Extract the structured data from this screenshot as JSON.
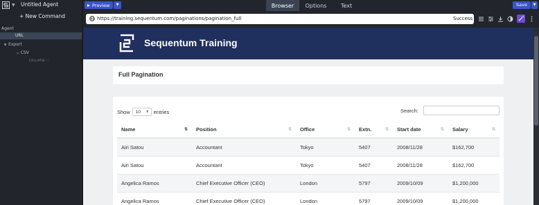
{
  "agent": {
    "title": "Untitled Agent",
    "new_command": "+ New Command"
  },
  "tree": {
    "agent": "Agent",
    "url": "URL",
    "export": "Export",
    "csv": "CSV",
    "collapse": "COLLAPSE"
  },
  "toolbar": {
    "preview": "Preview",
    "save": "Save",
    "tabs": [
      "Browser",
      "Options",
      "Text"
    ]
  },
  "address": {
    "url": "https://training.sequentum.com/paginations/pagination_full",
    "status": "Success"
  },
  "site": {
    "name": "Sequentum Training",
    "page_title": "Full Pagination"
  },
  "table": {
    "show_label": "Show",
    "entries_value": "10",
    "entries_label": "entries",
    "search_label": "Search:",
    "columns": [
      "Name",
      "Position",
      "Office",
      "Extn.",
      "Start date",
      "Salary"
    ],
    "rows": [
      [
        "Airi Satou",
        "Accountant",
        "Tokyo",
        "5407",
        "2008/11/28",
        "$162,700"
      ],
      [
        "Airi Satou",
        "Accountant",
        "Tokyo",
        "5407",
        "2008/11/28",
        "$162,700"
      ],
      [
        "Angelica Ramos",
        "Chief Executive Officer (CEO)",
        "London",
        "5797",
        "2009/10/09",
        "$1,200,000"
      ],
      [
        "Angelica Ramos",
        "Chief Executive Officer (CEO)",
        "London",
        "5797",
        "2009/10/09",
        "$1,200,000"
      ]
    ]
  },
  "colors": {
    "accent": "#3a55c9",
    "site_header": "#1f2f5e",
    "panel_bg": "#22262c"
  }
}
